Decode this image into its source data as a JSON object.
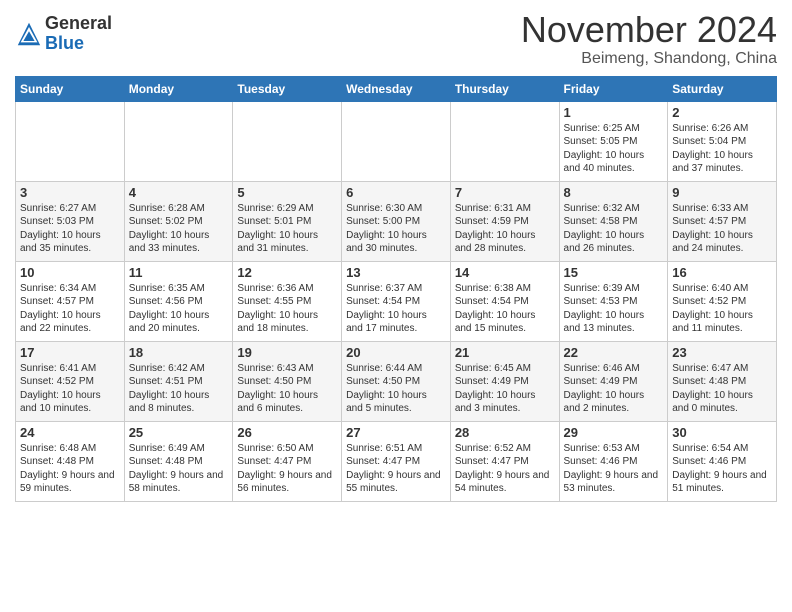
{
  "logo": {
    "general": "General",
    "blue": "Blue"
  },
  "title": "November 2024",
  "subtitle": "Beimeng, Shandong, China",
  "weekdays": [
    "Sunday",
    "Monday",
    "Tuesday",
    "Wednesday",
    "Thursday",
    "Friday",
    "Saturday"
  ],
  "weeks": [
    [
      {
        "day": "",
        "text": ""
      },
      {
        "day": "",
        "text": ""
      },
      {
        "day": "",
        "text": ""
      },
      {
        "day": "",
        "text": ""
      },
      {
        "day": "",
        "text": ""
      },
      {
        "day": "1",
        "text": "Sunrise: 6:25 AM\nSunset: 5:05 PM\nDaylight: 10 hours and 40 minutes."
      },
      {
        "day": "2",
        "text": "Sunrise: 6:26 AM\nSunset: 5:04 PM\nDaylight: 10 hours and 37 minutes."
      }
    ],
    [
      {
        "day": "3",
        "text": "Sunrise: 6:27 AM\nSunset: 5:03 PM\nDaylight: 10 hours and 35 minutes."
      },
      {
        "day": "4",
        "text": "Sunrise: 6:28 AM\nSunset: 5:02 PM\nDaylight: 10 hours and 33 minutes."
      },
      {
        "day": "5",
        "text": "Sunrise: 6:29 AM\nSunset: 5:01 PM\nDaylight: 10 hours and 31 minutes."
      },
      {
        "day": "6",
        "text": "Sunrise: 6:30 AM\nSunset: 5:00 PM\nDaylight: 10 hours and 30 minutes."
      },
      {
        "day": "7",
        "text": "Sunrise: 6:31 AM\nSunset: 4:59 PM\nDaylight: 10 hours and 28 minutes."
      },
      {
        "day": "8",
        "text": "Sunrise: 6:32 AM\nSunset: 4:58 PM\nDaylight: 10 hours and 26 minutes."
      },
      {
        "day": "9",
        "text": "Sunrise: 6:33 AM\nSunset: 4:57 PM\nDaylight: 10 hours and 24 minutes."
      }
    ],
    [
      {
        "day": "10",
        "text": "Sunrise: 6:34 AM\nSunset: 4:57 PM\nDaylight: 10 hours and 22 minutes."
      },
      {
        "day": "11",
        "text": "Sunrise: 6:35 AM\nSunset: 4:56 PM\nDaylight: 10 hours and 20 minutes."
      },
      {
        "day": "12",
        "text": "Sunrise: 6:36 AM\nSunset: 4:55 PM\nDaylight: 10 hours and 18 minutes."
      },
      {
        "day": "13",
        "text": "Sunrise: 6:37 AM\nSunset: 4:54 PM\nDaylight: 10 hours and 17 minutes."
      },
      {
        "day": "14",
        "text": "Sunrise: 6:38 AM\nSunset: 4:54 PM\nDaylight: 10 hours and 15 minutes."
      },
      {
        "day": "15",
        "text": "Sunrise: 6:39 AM\nSunset: 4:53 PM\nDaylight: 10 hours and 13 minutes."
      },
      {
        "day": "16",
        "text": "Sunrise: 6:40 AM\nSunset: 4:52 PM\nDaylight: 10 hours and 11 minutes."
      }
    ],
    [
      {
        "day": "17",
        "text": "Sunrise: 6:41 AM\nSunset: 4:52 PM\nDaylight: 10 hours and 10 minutes."
      },
      {
        "day": "18",
        "text": "Sunrise: 6:42 AM\nSunset: 4:51 PM\nDaylight: 10 hours and 8 minutes."
      },
      {
        "day": "19",
        "text": "Sunrise: 6:43 AM\nSunset: 4:50 PM\nDaylight: 10 hours and 6 minutes."
      },
      {
        "day": "20",
        "text": "Sunrise: 6:44 AM\nSunset: 4:50 PM\nDaylight: 10 hours and 5 minutes."
      },
      {
        "day": "21",
        "text": "Sunrise: 6:45 AM\nSunset: 4:49 PM\nDaylight: 10 hours and 3 minutes."
      },
      {
        "day": "22",
        "text": "Sunrise: 6:46 AM\nSunset: 4:49 PM\nDaylight: 10 hours and 2 minutes."
      },
      {
        "day": "23",
        "text": "Sunrise: 6:47 AM\nSunset: 4:48 PM\nDaylight: 10 hours and 0 minutes."
      }
    ],
    [
      {
        "day": "24",
        "text": "Sunrise: 6:48 AM\nSunset: 4:48 PM\nDaylight: 9 hours and 59 minutes."
      },
      {
        "day": "25",
        "text": "Sunrise: 6:49 AM\nSunset: 4:48 PM\nDaylight: 9 hours and 58 minutes."
      },
      {
        "day": "26",
        "text": "Sunrise: 6:50 AM\nSunset: 4:47 PM\nDaylight: 9 hours and 56 minutes."
      },
      {
        "day": "27",
        "text": "Sunrise: 6:51 AM\nSunset: 4:47 PM\nDaylight: 9 hours and 55 minutes."
      },
      {
        "day": "28",
        "text": "Sunrise: 6:52 AM\nSunset: 4:47 PM\nDaylight: 9 hours and 54 minutes."
      },
      {
        "day": "29",
        "text": "Sunrise: 6:53 AM\nSunset: 4:46 PM\nDaylight: 9 hours and 53 minutes."
      },
      {
        "day": "30",
        "text": "Sunrise: 6:54 AM\nSunset: 4:46 PM\nDaylight: 9 hours and 51 minutes."
      }
    ]
  ]
}
